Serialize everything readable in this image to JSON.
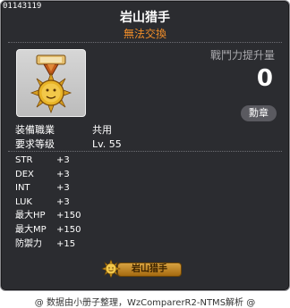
{
  "item": {
    "id": "01143119",
    "name": "岩山猎手",
    "note": "無法交換"
  },
  "power": {
    "label": "戰鬥力提升量",
    "value": "0"
  },
  "badge_label": "勳章",
  "requirements": [
    {
      "label": "装備職業",
      "value": "共用"
    },
    {
      "label": "要求等级",
      "value": "Lv. 55"
    }
  ],
  "stats": [
    {
      "label": "STR",
      "value": "+3"
    },
    {
      "label": "DEX",
      "value": "+3"
    },
    {
      "label": "INT",
      "value": "+3"
    },
    {
      "label": "LUK",
      "value": "+3"
    },
    {
      "label": "最大HP",
      "value": "+150"
    },
    {
      "label": "最大MP",
      "value": "+150"
    },
    {
      "label": "防禦力",
      "value": "+15"
    }
  ],
  "title_tag": "岩山猎手",
  "footer": "@ 数据由小册子整理，WzComparerR2-NTMS解析 @",
  "colors": {
    "panel_bg": "#2b2c30",
    "note_orange": "#f18d28",
    "text_white": "#ffffff",
    "label_gray": "#a8a8ac",
    "medal_gold": "#d8a020"
  },
  "icons": {
    "item_icon": "medal-icon",
    "title_icon": "sun-medal-icon"
  }
}
